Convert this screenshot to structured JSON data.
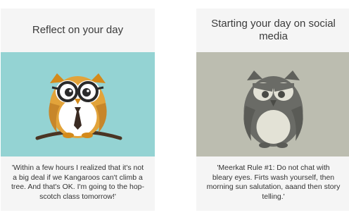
{
  "cards": [
    {
      "title": "Reflect on your day",
      "image_icon": "owl-with-glasses-icon",
      "image_bg": "#94d3d3",
      "quote": "'Within a few hours I realized that it's not a big deal if we Kangaroos can't climb a tree. And that's OK. I'm going to the hop-scotch class tomorrow!'"
    },
    {
      "title": "Starting your day on social media",
      "image_icon": "grumpy-owl-icon",
      "image_bg": "#bcbdb0",
      "quote": "'Meerkat Rule #1: Do not chat with bleary eyes. Firts wash yourself, then morning sun salutation, aaand then story telling.'"
    }
  ]
}
